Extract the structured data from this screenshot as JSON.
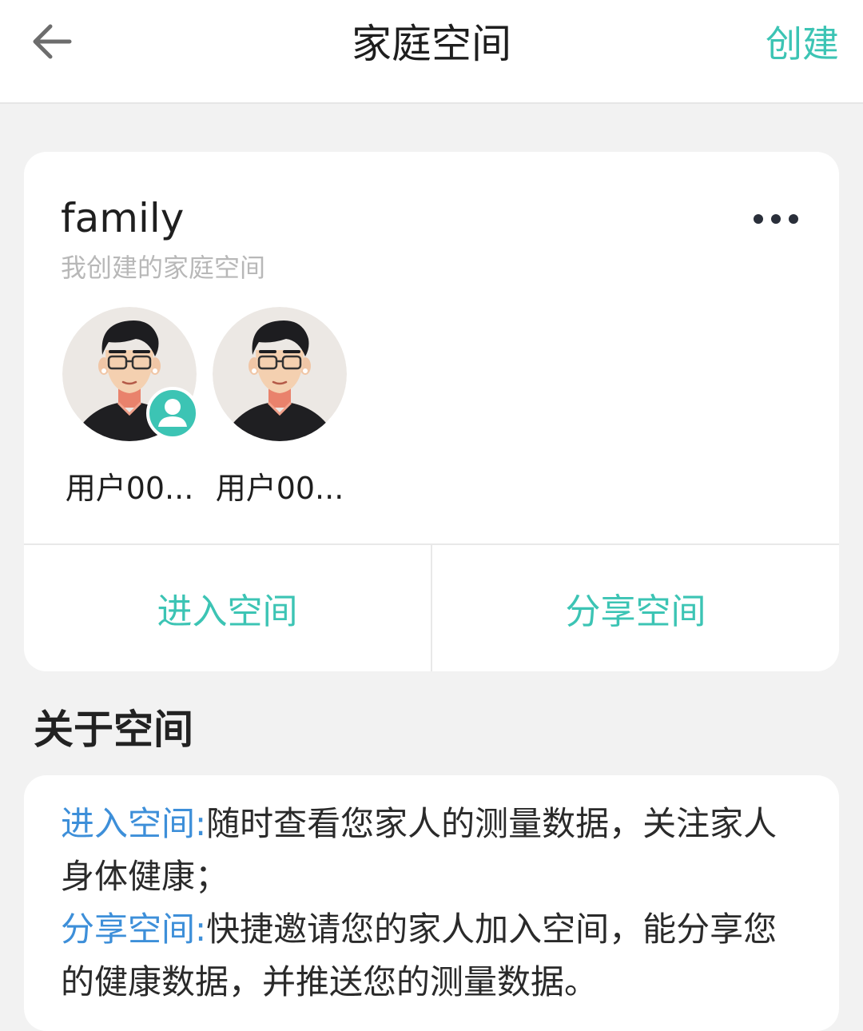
{
  "header": {
    "back_icon": "arrow-left-icon",
    "title": "家庭空间",
    "create_label": "创建"
  },
  "family_card": {
    "name": "family",
    "subtitle": "我创建的家庭空间",
    "more_icon": "more-horizontal-icon",
    "members": [
      {
        "label": "用户00...",
        "is_owner": true,
        "owner_badge_icon": "user-badge-icon"
      },
      {
        "label": "用户00...",
        "is_owner": false
      }
    ],
    "actions": {
      "enter_label": "进入空间",
      "share_label": "分享空间"
    }
  },
  "about": {
    "heading": "关于空间",
    "items": [
      {
        "key": "进入空间:",
        "text": "随时查看您家人的测量数据，关注家人身体健康；"
      },
      {
        "key": "分享空间:",
        "text": "快捷邀请您的家人加入空间，能分享您的健康数据，并推送您的测量数据。"
      }
    ]
  },
  "colors": {
    "accent": "#3cc4b4",
    "link_blue": "#3d8fd9",
    "background": "#f2f2f2",
    "card": "#ffffff",
    "muted_text": "#b8b8b8"
  }
}
